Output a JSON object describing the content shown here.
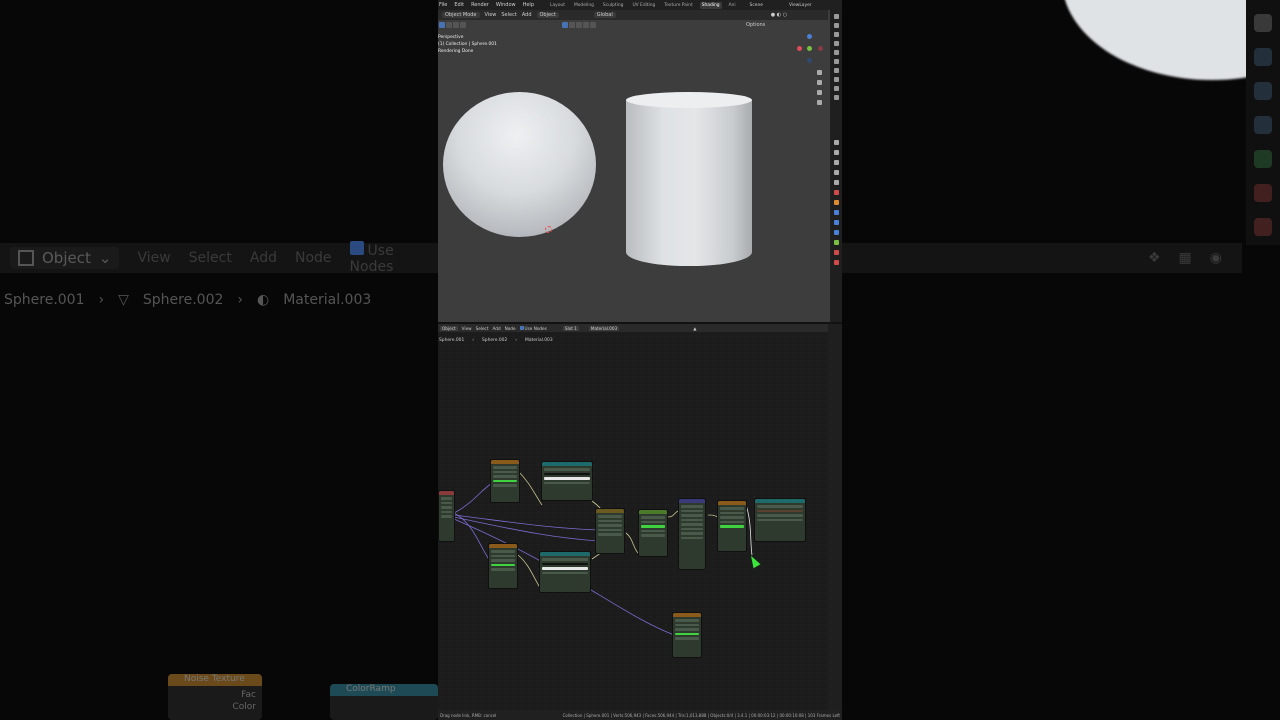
{
  "menu": [
    "File",
    "Edit",
    "Render",
    "Window",
    "Help"
  ],
  "workspaces": [
    "Layout",
    "Modeling",
    "Sculpting",
    "UV Editing",
    "Texture Paint",
    "Shading",
    "Ani"
  ],
  "active_workspace": "Shading",
  "scene": "Scene",
  "view_layer": "ViewLayer",
  "viewport": {
    "mode": "Object Mode",
    "menus": [
      "View",
      "Select",
      "Add",
      "Object"
    ],
    "orientation": "Global",
    "options": "Options",
    "info_lines": [
      "Perspective",
      "(1) Collection | Sphere.001",
      "Rendering Done"
    ]
  },
  "node_editor": {
    "mode": "Object",
    "menus": [
      "View",
      "Select",
      "Add",
      "Node"
    ],
    "use_nodes": "Use Nodes",
    "slot": "Slot 1",
    "material": "Material.003",
    "breadcrumb": [
      "Sphere.001",
      "Sphere.002",
      "Material.003"
    ]
  },
  "background": {
    "header_mode": "Object",
    "menus": [
      "View",
      "Select",
      "Add",
      "Node"
    ],
    "use_nodes": "Use Nodes",
    "breadcrumb": [
      "Sphere.001",
      "Sphere.002",
      "Material.003"
    ],
    "node_noise": "Noise Texture",
    "node_colorramp": "ColorRamp",
    "socket_fac": "Fac",
    "socket_color": "Color"
  },
  "statusbar": {
    "left": "Drag node link, RMB: cancel",
    "right": "Collection | Sphere.001 | Verts:506,943 | Faces:506,944 | Tris:1,013,888 | Objects:0/4 | 3.4.1 | 00:00:03:12 | 00:00:10:08 | 103 Frames Left"
  },
  "colors": {
    "viewport_bg": "#3d3d3d",
    "editor_bg": "#1c1c1c",
    "accent": "#4772b3",
    "node_green": "#3fd43f",
    "wire_purple": "#7b6cd0",
    "wire_yellow": "#c8c890"
  }
}
